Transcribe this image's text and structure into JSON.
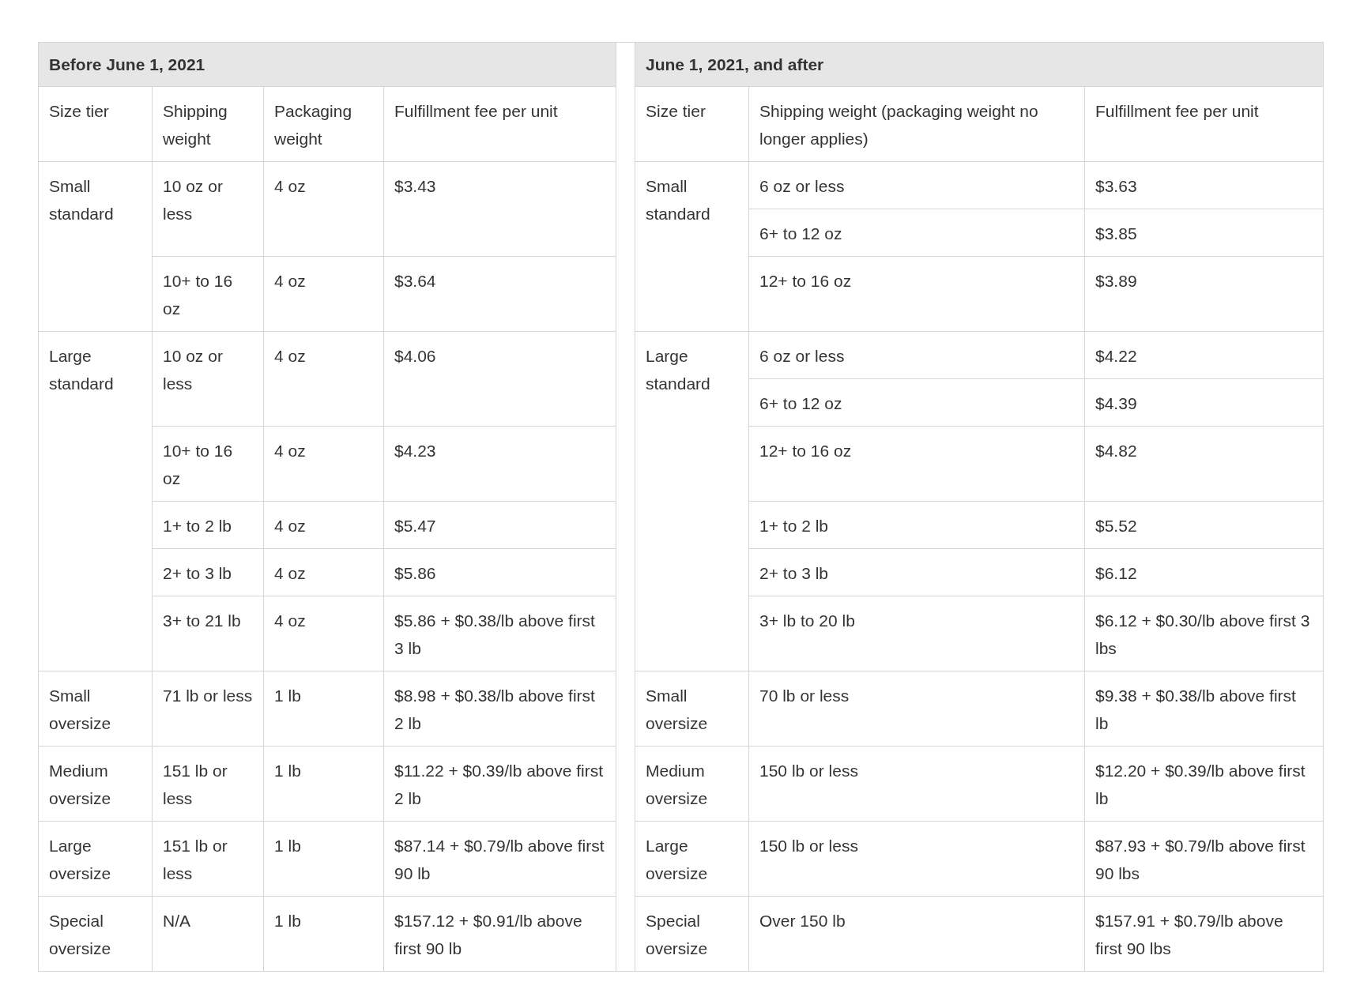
{
  "tables": [
    {
      "title": "Before June 1, 2021",
      "columns": [
        "Size tier",
        "Shipping weight",
        "Packaging weight",
        "Fulfillment fee per unit"
      ],
      "groups": [
        {
          "size_tier": "Small standard",
          "rows": [
            [
              "10 oz or less",
              "4 oz",
              "$3.43"
            ],
            [
              "10+ to 16 oz",
              "4 oz",
              "$3.64"
            ]
          ]
        },
        {
          "size_tier": "Large standard",
          "rows": [
            [
              "10 oz or less",
              "4 oz",
              "$4.06"
            ],
            [
              "10+ to 16 oz",
              "4 oz",
              "$4.23"
            ],
            [
              "1+ to 2 lb",
              "4 oz",
              "$5.47"
            ],
            [
              "2+ to 3 lb",
              "4 oz",
              "$5.86"
            ],
            [
              "3+ to 21 lb",
              "4 oz",
              "$5.86 + $0.38/lb above first 3 lb"
            ]
          ]
        },
        {
          "size_tier": "Small oversize",
          "rows": [
            [
              "71 lb or less",
              "1 lb",
              "$8.98 + $0.38/lb above first 2 lb"
            ]
          ]
        },
        {
          "size_tier": "Medium oversize",
          "rows": [
            [
              "151 lb or less",
              "1 lb",
              "$11.22 + $0.39/lb above first 2 lb"
            ]
          ]
        },
        {
          "size_tier": "Large oversize",
          "rows": [
            [
              "151 lb or less",
              "1 lb",
              "$87.14 + $0.79/lb above first 90 lb"
            ]
          ]
        },
        {
          "size_tier": "Special oversize",
          "rows": [
            [
              "N/A",
              "1 lb",
              "$157.12 + $0.91/lb above first 90 lb"
            ]
          ]
        }
      ]
    },
    {
      "title": "June 1, 2021, and after",
      "columns": [
        "Size tier",
        "Shipping weight (packaging weight no longer applies)",
        "Fulfillment fee per unit"
      ],
      "groups": [
        {
          "size_tier": "Small standard",
          "rows": [
            [
              "6 oz or less",
              "$3.63"
            ],
            [
              "6+ to 12 oz",
              "$3.85"
            ],
            [
              "12+ to 16 oz",
              "$3.89"
            ]
          ]
        },
        {
          "size_tier": "Large standard",
          "rows": [
            [
              "6 oz or less",
              "$4.22"
            ],
            [
              "6+ to 12 oz",
              "$4.39"
            ],
            [
              "12+ to 16 oz",
              "$4.82"
            ],
            [
              "1+ to 2 lb",
              "$5.52"
            ],
            [
              "2+ to 3 lb",
              "$6.12"
            ],
            [
              "3+ lb to 20 lb",
              "$6.12 + $0.30/lb above first 3 lbs"
            ]
          ]
        },
        {
          "size_tier": "Small oversize",
          "rows": [
            [
              "70 lb or less",
              "$9.38 + $0.38/lb above first lb"
            ]
          ]
        },
        {
          "size_tier": "Medium oversize",
          "rows": [
            [
              "150 lb or less",
              "$12.20 + $0.39/lb above first lb"
            ]
          ]
        },
        {
          "size_tier": "Large oversize",
          "rows": [
            [
              "150 lb or less",
              "$87.93 + $0.79/lb above first 90 lbs"
            ]
          ]
        },
        {
          "size_tier": "Special oversize",
          "rows": [
            [
              "Over 150 lb",
              "$157.91 + $0.79/lb above first 90 lbs"
            ]
          ]
        }
      ]
    }
  ]
}
